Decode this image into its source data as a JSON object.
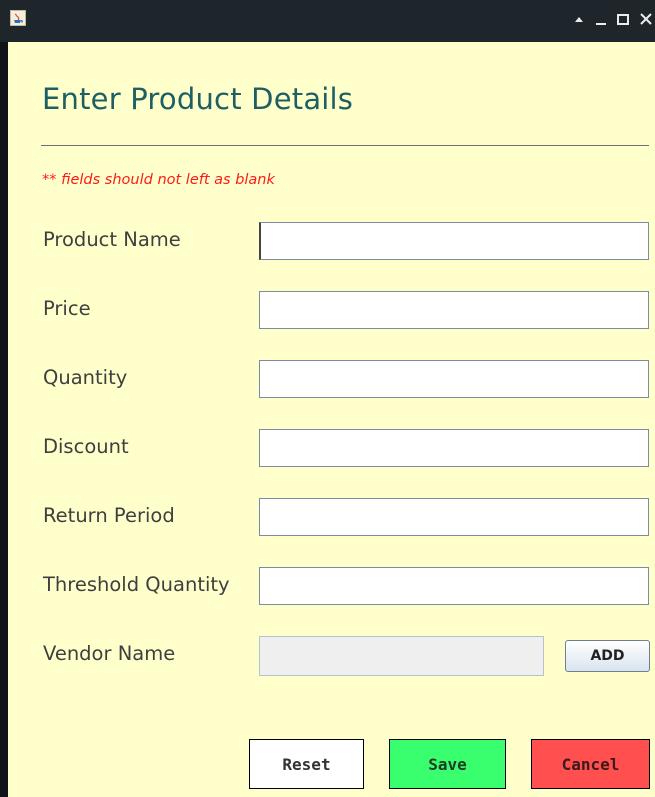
{
  "window": {
    "controls": [
      "shade-icon",
      "minimize-icon",
      "maximize-icon",
      "close-icon"
    ]
  },
  "form": {
    "title": "Enter Product Details",
    "hint": "** fields should not left as blank",
    "fields": [
      {
        "label": "Product Name",
        "value": ""
      },
      {
        "label": "Price",
        "value": ""
      },
      {
        "label": "Quantity",
        "value": ""
      },
      {
        "label": "Discount",
        "value": ""
      },
      {
        "label": "Return Period",
        "value": ""
      },
      {
        "label": "Threshold Quantity",
        "value": ""
      }
    ],
    "vendor": {
      "label": "Vendor Name",
      "value": "",
      "add_label": "ADD"
    }
  },
  "actions": {
    "reset_label": "Reset",
    "save_label": "Save",
    "cancel_label": "Cancel"
  },
  "colors": {
    "background": "#ffffcc",
    "title": "#1d5f63",
    "hint": "#ff1a1a",
    "save": "#39ff6e",
    "cancel": "#ff4f4f"
  }
}
